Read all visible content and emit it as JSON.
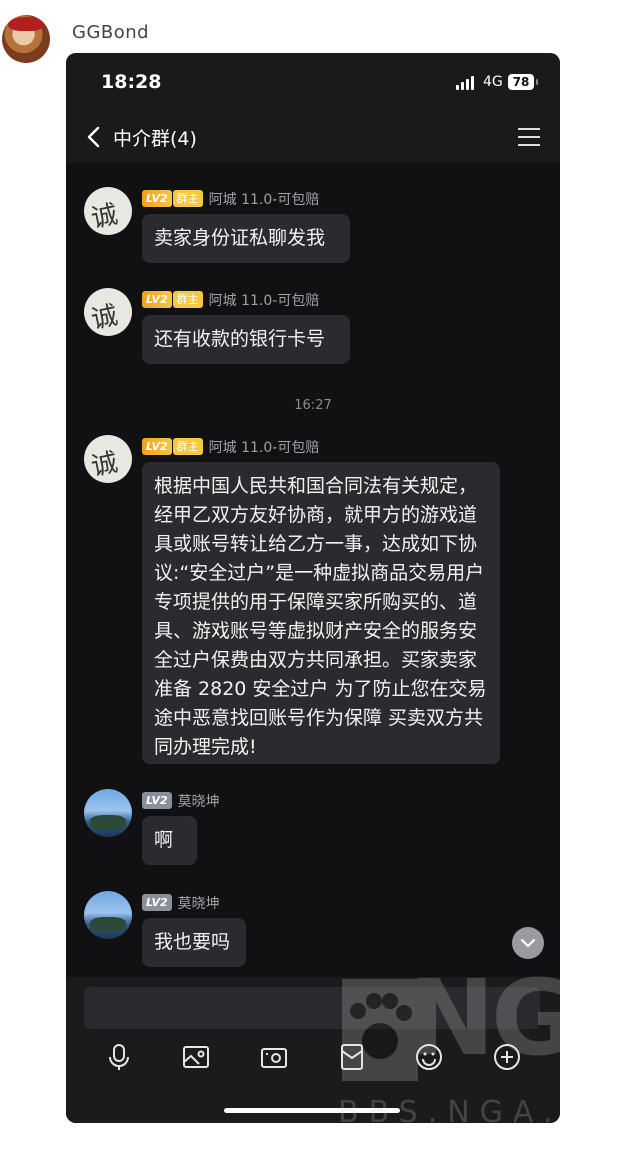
{
  "post": {
    "author": "GGBond"
  },
  "status_bar": {
    "time": "18:28",
    "network": "4G",
    "battery": "78"
  },
  "chat": {
    "title": "中介群(4)",
    "timestamp": "16:27",
    "messages": [
      {
        "level": "LV2",
        "role": "群主",
        "sender": "阿城 11.0-可包赔",
        "text": "卖家身份证私聊发我",
        "avatar": "诚"
      },
      {
        "level": "LV2",
        "role": "群主",
        "sender": "阿城 11.0-可包赔",
        "text": "还有收款的银行卡号",
        "avatar": "诚"
      },
      {
        "level": "LV2",
        "role": "群主",
        "sender": "阿城 11.0-可包赔",
        "text": "根据中国人民共和国合同法有关规定，经甲乙双方友好协商，就甲方的游戏道具或账号转让给乙方一事，达成如下协议:“安全过户”是一种虚拟商品交易用户专项提供的用于保障买家所购买的、道具、游戏账号等虚拟财产安全的服务安全过户保费由双方共同承担。买家卖家准备 2820 安全过户 为了防止您在交易途中恶意找回账号作为保障 买卖双方共同办理完成!",
        "avatar": "诚"
      },
      {
        "level": "LV2",
        "sender": "莫晓坤",
        "text": "啊"
      },
      {
        "level": "LV2",
        "sender": "莫晓坤",
        "text": "我也要吗"
      }
    ]
  },
  "toolbar": {
    "icons": [
      "microphone-icon",
      "image-icon",
      "camera-icon",
      "red-packet-icon",
      "emoji-icon",
      "plus-icon"
    ]
  },
  "watermark": {
    "big": "NGA",
    "small": "BBS.NGA.C"
  },
  "colors": {
    "background": "#111113",
    "bubble": "#2b2b2f",
    "owner_badge": "#f5c842",
    "member_badge": "#8a8f9a"
  }
}
